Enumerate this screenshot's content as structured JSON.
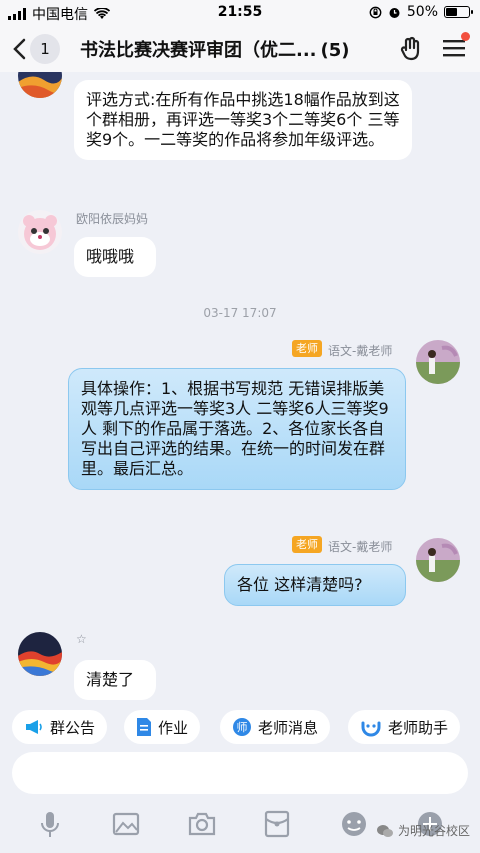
{
  "status": {
    "carrier": "中国电信",
    "time": "21:55",
    "battery": "50%",
    "battery_level": 0.5
  },
  "header": {
    "back_count": "1",
    "title": "书法比赛决赛评审团（优二...",
    "member_count": "(5)"
  },
  "messages": [
    {
      "type": "in",
      "text": "评选方式:在所有作品中挑选18幅作品放到这个群相册，再评选一等奖3个二等奖6个 三等奖9个。一二等奖的作品将参加年级评选。"
    },
    {
      "type": "in",
      "sender": "欧阳依辰妈妈",
      "text": "哦哦哦"
    },
    {
      "type": "time",
      "text": "03-17 17:07"
    },
    {
      "type": "out",
      "badge": "老师",
      "sender": "语文-戴老师",
      "text": "具体操作：1、根据书写规范 无错误排版美观等几点评选一等奖3人 二等奖6人三等奖9人 剩下的作品属于落选。2、各位家长各自写出自己评选的结果。在统一的时间发在群里。最后汇总。"
    },
    {
      "type": "out",
      "badge": "老师",
      "sender": "语文-戴老师",
      "text": "各位 这样清楚吗?"
    },
    {
      "type": "in",
      "sender": "☆",
      "text": "清楚了"
    }
  ],
  "chips": [
    {
      "label": "群公告",
      "icon": "megaphone-icon"
    },
    {
      "label": "作业",
      "icon": "document-icon"
    },
    {
      "label": "老师消息",
      "icon": "teacher-icon"
    },
    {
      "label": "老师助手",
      "icon": "assistant-icon"
    }
  ],
  "toolbar": [
    "microphone-icon",
    "image-icon",
    "camera-icon",
    "red-packet-icon",
    "emoji-icon",
    "plus-icon"
  ],
  "watermark": "为明光谷校区",
  "colors": {
    "accent_blue": "#a9d8f7",
    "badge_orange": "#f5a623",
    "background": "#eef0f6"
  }
}
